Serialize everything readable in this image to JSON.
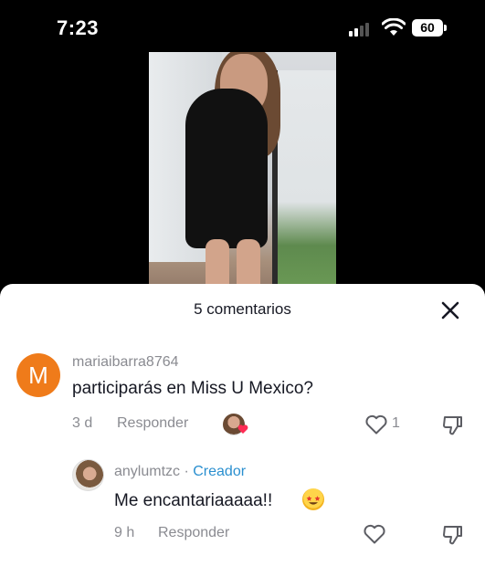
{
  "status_bar": {
    "time": "7:23",
    "battery": "60"
  },
  "sheet": {
    "title": "5 comentarios"
  },
  "comments": [
    {
      "avatar_letter": "M",
      "username": "mariaibarra8764",
      "text": "participarás en Miss U Mexico?",
      "age": "3 d",
      "reply_label": "Responder",
      "likes": "1"
    },
    {
      "username": "anylumtzc",
      "badge_separator": " · ",
      "badge": "Creador",
      "text": "Me encantariaaaaa!!",
      "age": "9 h",
      "reply_label": "Responder"
    }
  ],
  "colors": {
    "avatar_bg": "#ef7b1a",
    "creator_badge": "#2a8fcf",
    "liked_heart": "#fe2c55"
  },
  "icons": [
    "signal-icon",
    "wifi-icon",
    "battery-icon",
    "close-icon",
    "heart-icon",
    "dislike-icon",
    "star-struck-emoji"
  ]
}
